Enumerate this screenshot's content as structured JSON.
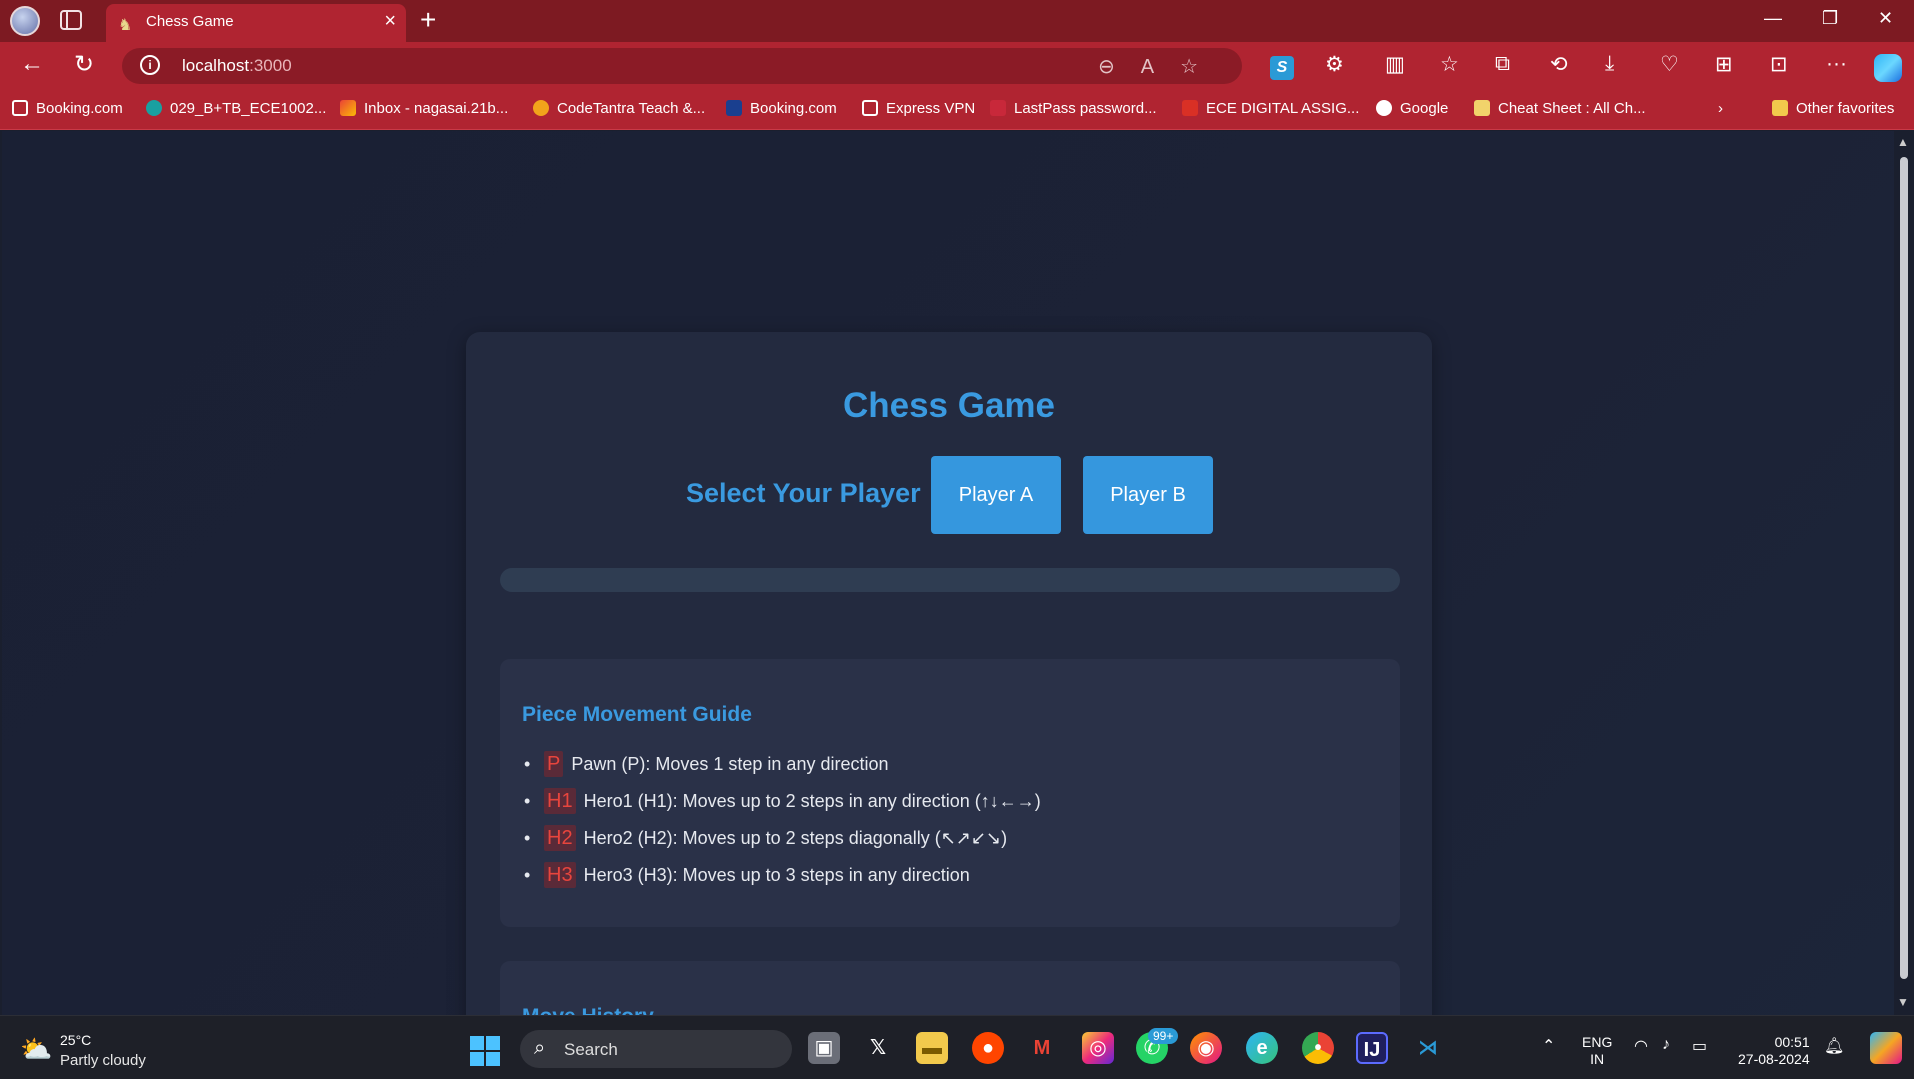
{
  "browser": {
    "tab_title": "Chess Game",
    "url_host": "localhost",
    "url_port": ":3000",
    "bookmarks": [
      "Booking.com",
      "029_B+TB_ECE1002...",
      "Inbox - nagasai.21b...",
      "CodeTantra Teach &...",
      "Booking.com",
      "Express VPN",
      "LastPass password...",
      "ECE DIGITAL ASSIG...",
      "Google",
      "Cheat Sheet : All Ch...",
      "Other favorites"
    ]
  },
  "page": {
    "title": "Chess Game",
    "select_label": "Select Your Player",
    "player_a": "Player A",
    "player_b": "Player B",
    "guide_title": "Piece Movement Guide",
    "pieces": [
      {
        "tag": "P",
        "text": "Pawn (P): Moves 1 step in any direction"
      },
      {
        "tag": "H1",
        "text": "Hero1 (H1): Moves up to 2 steps in any direction (↑↓←→)"
      },
      {
        "tag": "H2",
        "text": "Hero2 (H2): Moves up to 2 steps diagonally (↖↗↙↘)"
      },
      {
        "tag": "H3",
        "text": "Hero3 (H3): Moves up to 3 steps in any direction"
      }
    ],
    "history_title": "Move History"
  },
  "taskbar": {
    "temp": "25°C",
    "weather": "Partly cloudy",
    "search": "Search",
    "badge": "99+",
    "lang1": "ENG",
    "lang2": "IN",
    "time": "00:51",
    "date": "27-08-2024"
  },
  "colors": {
    "accent": "#3a9ae0",
    "button": "#3597de",
    "card": "#232a3f",
    "piece_tag": "#e8453d"
  }
}
